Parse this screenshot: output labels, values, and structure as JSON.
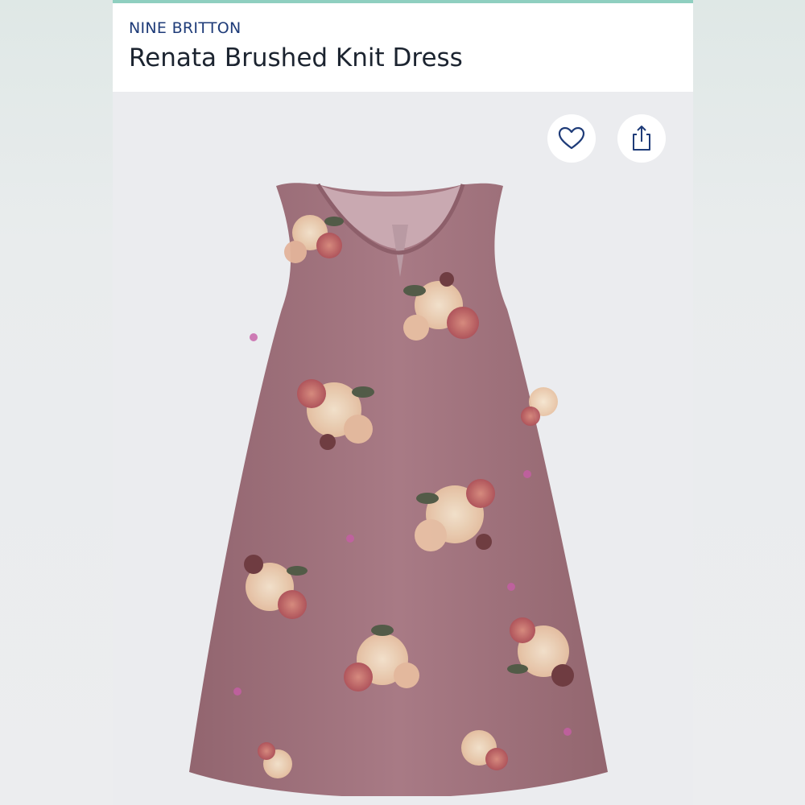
{
  "product": {
    "brand": "NINE BRITTON",
    "title": "Renata Brushed Knit Dress"
  },
  "actions": {
    "favorite_icon": "heart-icon",
    "share_icon": "share-icon"
  },
  "colors": {
    "brand_text": "#1e3b78",
    "accent": "#8fcfc0",
    "dress": "#a77a84"
  }
}
